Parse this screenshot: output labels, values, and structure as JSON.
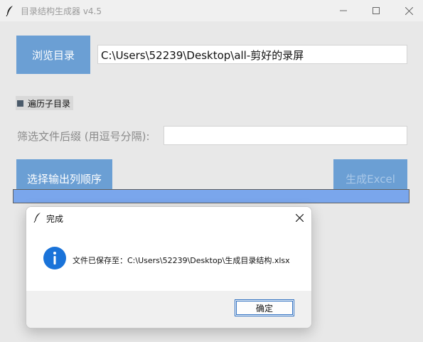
{
  "window": {
    "title": "目录结构生成器 v4.5",
    "app_icon": "feather-icon",
    "controls": [
      "minimize-icon",
      "maximize-icon",
      "close-icon"
    ]
  },
  "main": {
    "browse_button": "浏览目录",
    "path_value": "C:\\Users\\52239\\Desktop\\all-剪好的录屏",
    "recurse_checkbox": {
      "label": "遍历子目录",
      "checked": true
    },
    "filter_label": "筛选文件后缀 (用逗号分隔):",
    "filter_value": "",
    "order_button": "选择输出列顺序",
    "generate_button": {
      "label": "生成Excel",
      "enabled": false
    },
    "progress": {
      "value_percent": 100
    }
  },
  "dialog": {
    "title": "完成",
    "icon": "info-icon",
    "message": "文件已保存至：C:\\Users\\52239\\Desktop\\生成目录结构.xlsx",
    "ok_button": "确定"
  },
  "colors": {
    "accent": "#6b9fd4",
    "progress_fill": "#7aa6ec",
    "info_blue": "#1a73d9"
  }
}
